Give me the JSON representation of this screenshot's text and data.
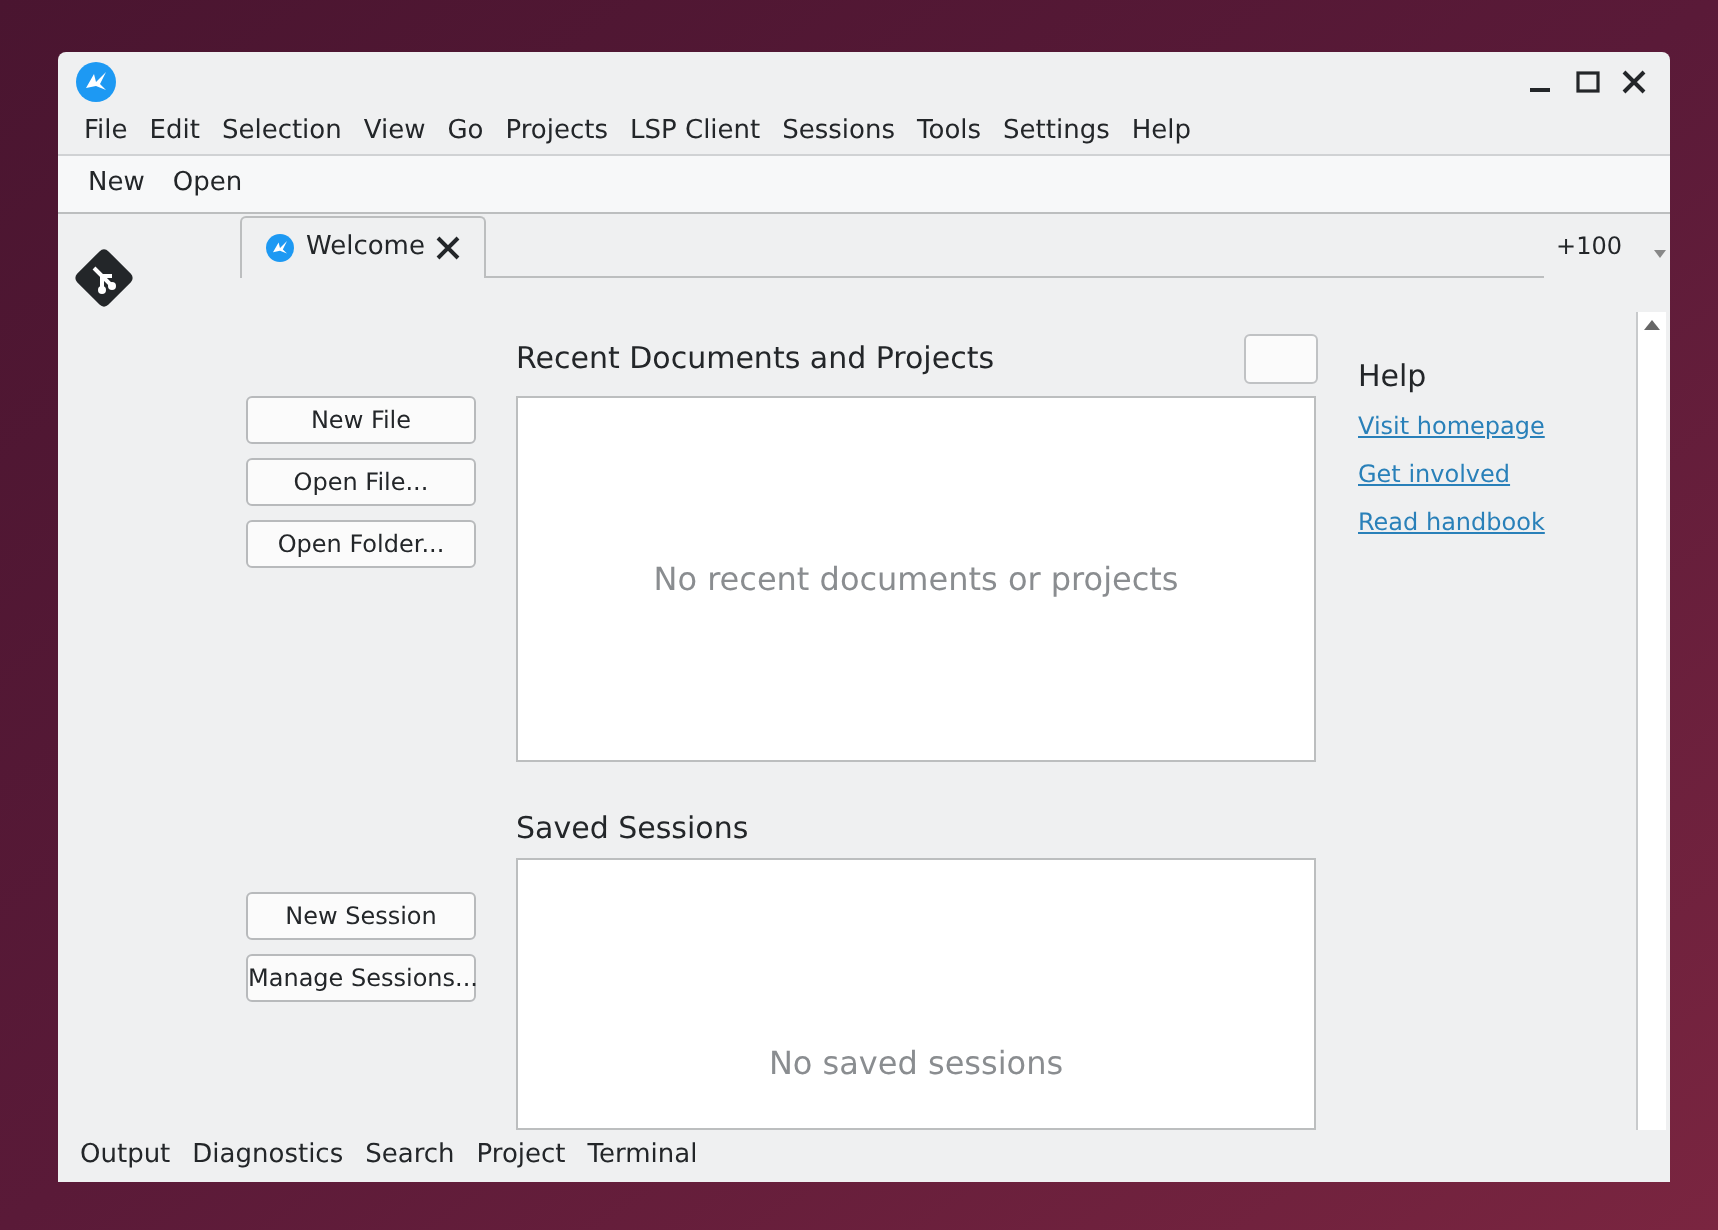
{
  "menu": [
    "File",
    "Edit",
    "Selection",
    "View",
    "Go",
    "Projects",
    "LSP Client",
    "Sessions",
    "Tools",
    "Settings",
    "Help"
  ],
  "toolbar": [
    "New",
    "Open"
  ],
  "tabs": [
    {
      "label": "Welcome",
      "selected": true
    }
  ],
  "zoom_label": "+100",
  "actions": [
    "New File",
    "Open File...",
    "Open Folder..."
  ],
  "recent": {
    "title": "Recent Documents and Projects",
    "empty_text": "No recent documents or projects"
  },
  "help": {
    "title": "Help",
    "links": [
      "Visit homepage",
      "Get involved",
      "Read handbook"
    ]
  },
  "session_actions": [
    "New Session",
    "Manage Sessions..."
  ],
  "sessions": {
    "title": "Saved Sessions",
    "empty_text": "No saved sessions"
  },
  "bottom_tabs": [
    "Output",
    "Diagnostics",
    "Search",
    "Project",
    "Terminal"
  ]
}
